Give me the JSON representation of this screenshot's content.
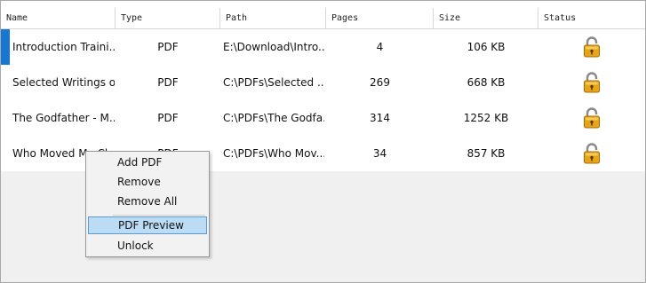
{
  "columns": [
    "Name",
    "Type",
    "Path",
    "Pages",
    "Size",
    "Status"
  ],
  "rows": [
    {
      "name": "Introduction Traini...",
      "type": "PDF",
      "path": "E:\\Download\\Intro...",
      "pages": "4",
      "size": "106 KB",
      "status_icon": "unlocked-padlock-icon"
    },
    {
      "name": "Selected Writings o...",
      "type": "PDF",
      "path": "C:\\PDFs\\Selected ...",
      "pages": "269",
      "size": "668 KB",
      "status_icon": "unlocked-padlock-icon"
    },
    {
      "name": "The Godfather - M...",
      "type": "PDF",
      "path": "C:\\PDFs\\The Godfa...",
      "pages": "314",
      "size": "1252 KB",
      "status_icon": "unlocked-padlock-icon"
    },
    {
      "name": "Who Moved My Ch...",
      "type": "PDF",
      "path": "C:\\PDFs\\Who Mov...",
      "pages": "34",
      "size": "857 KB",
      "status_icon": "unlocked-padlock-icon"
    }
  ],
  "context_menu": {
    "add_pdf": "Add PDF",
    "remove": "Remove",
    "remove_all": "Remove All",
    "pdf_preview": "PDF Preview",
    "unlock": "Unlock"
  },
  "colors": {
    "selection_marker": "#1877d2",
    "menu_highlight": "#bcdcf6",
    "lock_gold": "#e8a317"
  }
}
